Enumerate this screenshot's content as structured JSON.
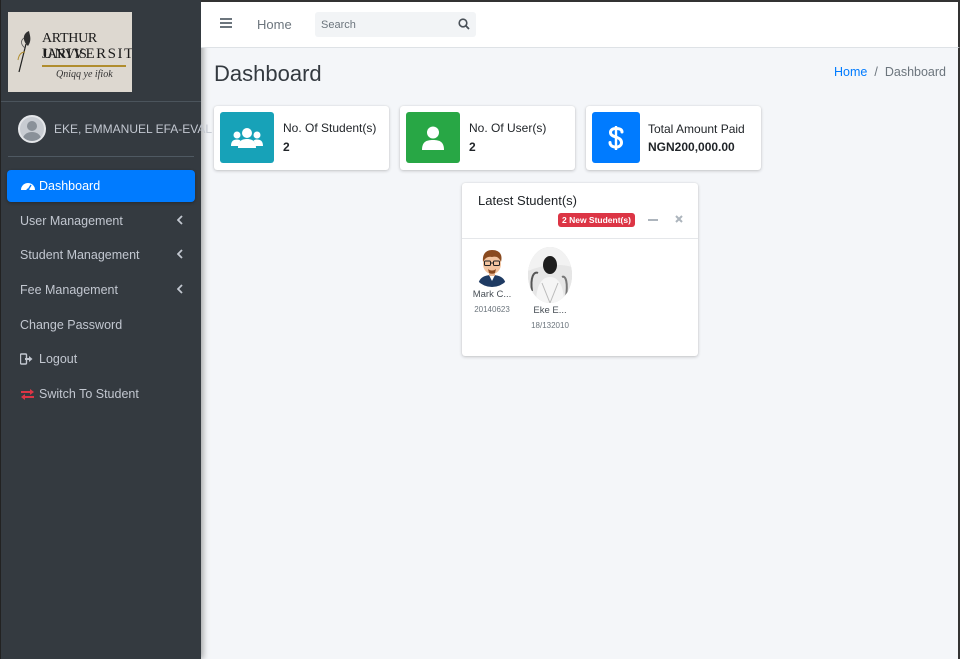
{
  "brand": {
    "line1": "ARTHUR JARVIS",
    "line2": "UNIVERSITY",
    "motto": "Qniqq ye ifiok"
  },
  "user": {
    "name": "EKE, EMMANUEL EFA-EVAL"
  },
  "sidebar": {
    "items": [
      {
        "label": "Dashboard",
        "icon": "tachometer-icon",
        "active": true
      },
      {
        "label": "User Management",
        "icon": "",
        "has_submenu": true
      },
      {
        "label": "Student Management",
        "icon": "",
        "has_submenu": true
      },
      {
        "label": "Fee Management",
        "icon": "",
        "has_submenu": true
      },
      {
        "label": "Change Password",
        "icon": ""
      },
      {
        "label": "Logout",
        "icon": "sign-out-icon"
      },
      {
        "label": "Switch To Student",
        "icon": "exchange-icon"
      }
    ]
  },
  "topbar": {
    "home_label": "Home",
    "search_placeholder": "Search"
  },
  "page": {
    "title": "Dashboard",
    "breadcrumb": [
      "Home",
      "Dashboard"
    ]
  },
  "info_boxes": [
    {
      "label": "No. Of Student(s)",
      "value": "2",
      "icon": "users-icon",
      "color": "#17a2b8"
    },
    {
      "label": "No. Of User(s)",
      "value": "2",
      "icon": "user-icon",
      "color": "#28a745"
    },
    {
      "label": "Total Amount Paid",
      "value": "NGN200,000.00",
      "icon": "dollar-icon",
      "color": "#007bff"
    }
  ],
  "latest_students": {
    "title": "Latest Student(s)",
    "badge": "2 New Student(s)",
    "badge_color": "#dc3545",
    "students": [
      {
        "name": "Mark C...",
        "id": "20140623"
      },
      {
        "name": "Eke E...",
        "id": "18/132010"
      }
    ]
  },
  "colors": {
    "sidebar_bg": "#343a40",
    "accent": "#007bff",
    "content_bg": "#f4f6f9"
  }
}
